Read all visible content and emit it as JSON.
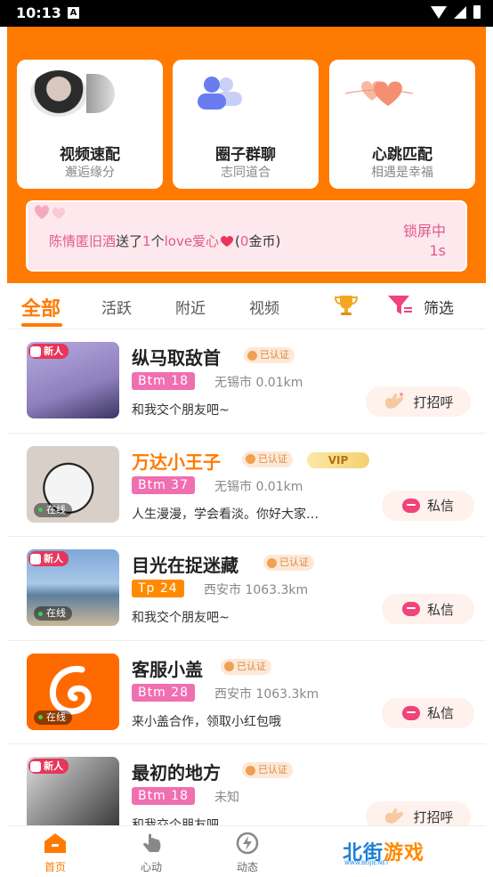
{
  "status_bar": {
    "time": "10:13",
    "notif_letter": "A"
  },
  "features": [
    {
      "title": "视频速配",
      "sub": "邂逅缘分"
    },
    {
      "title": "圈子群聊",
      "sub": "志同道合"
    },
    {
      "title": "心跳匹配",
      "sub": "相遇是幸福"
    }
  ],
  "gift": {
    "sender": "陈情匿旧酒",
    "sent": "送了",
    "count": "1",
    "unit": "个",
    "gift_name": "love爱心",
    "paren_open": "(",
    "coins": "0",
    "coin_label": "金币)",
    "lock_label": "锁屏中",
    "lock_seconds": "1s"
  },
  "tabs": {
    "all": "全部",
    "active": "活跃",
    "nearby": "附近",
    "video": "视频",
    "filter": "筛选"
  },
  "users": [
    {
      "name": "纵马取敌首",
      "cert": "已认证",
      "tag": "Btm 18",
      "location": "无锡市 0.01km",
      "desc": "和我交个朋友吧~",
      "action": "打招呼",
      "new_badge": "新人"
    },
    {
      "name": "万达小王子",
      "cert": "已认证",
      "vip": "VIP",
      "tag": "Btm 37",
      "location": "无锡市 0.01km",
      "desc": "人生漫漫，学会看淡。你好大家…",
      "action": "私信",
      "online": "在线"
    },
    {
      "name": "目光在捉迷藏",
      "cert": "已认证",
      "tag": "Tp 24",
      "location": "西安市 1063.3km",
      "desc": "和我交个朋友吧~",
      "action": "私信",
      "new_badge": "新人",
      "online": "在线"
    },
    {
      "name": "客服小盖",
      "cert": "已认证",
      "tag": "Btm 28",
      "location": "西安市 1063.3km",
      "desc": "来小盖合作，领取小红包哦",
      "action": "私信",
      "online": "在线"
    },
    {
      "name": "最初的地方",
      "cert": "已认证",
      "tag": "Btm 18",
      "location": "未知",
      "desc": "和我交个朋友吧",
      "action": "打招呼",
      "new_badge": "新人"
    }
  ],
  "bottom_nav": {
    "home": "首页",
    "heart": "心动",
    "moments": "动态"
  },
  "watermark": {
    "text_a": "北街",
    "text_b": "游戏",
    "url": "WWW.BEIJIE.NET"
  },
  "colors": {
    "brand": "#ff7a00",
    "pink": "#e05a8a",
    "tag_pink": "#f06fb0",
    "tag_orange": "#ff8a00"
  }
}
